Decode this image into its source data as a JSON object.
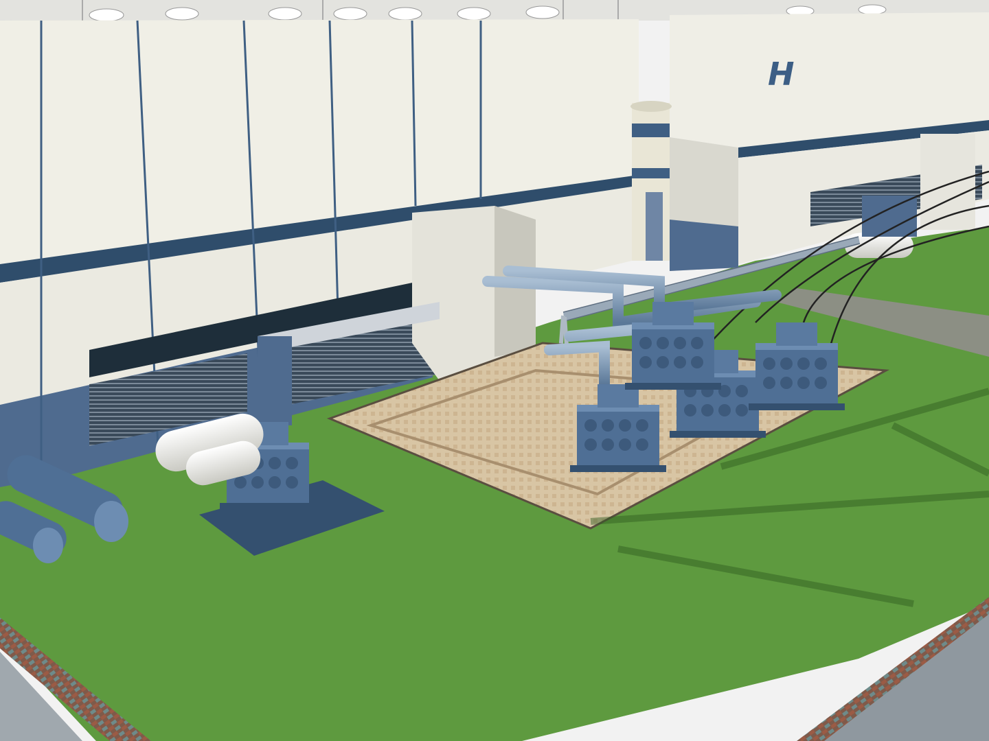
{
  "scene": {
    "subject": "power-plant-substation-render",
    "logo": {
      "text": "H"
    },
    "colors": {
      "sky": "#f2f2f2",
      "grass": "#5e9a3f",
      "grass_dark": "#3f7029",
      "building_wall": "#f0efe6",
      "building_shadow": "#c9c8bf",
      "stripe": "#2f4d6b",
      "lower_wall": "#4f6b8f",
      "equipment": "#4f6f95",
      "equipment_dark": "#34506f",
      "pipe": "#7d97b3",
      "tank": "#f3f3ee",
      "pad": "#d9c7a6",
      "brick": "#8e4f3e",
      "road": "#9aa3ad"
    }
  }
}
